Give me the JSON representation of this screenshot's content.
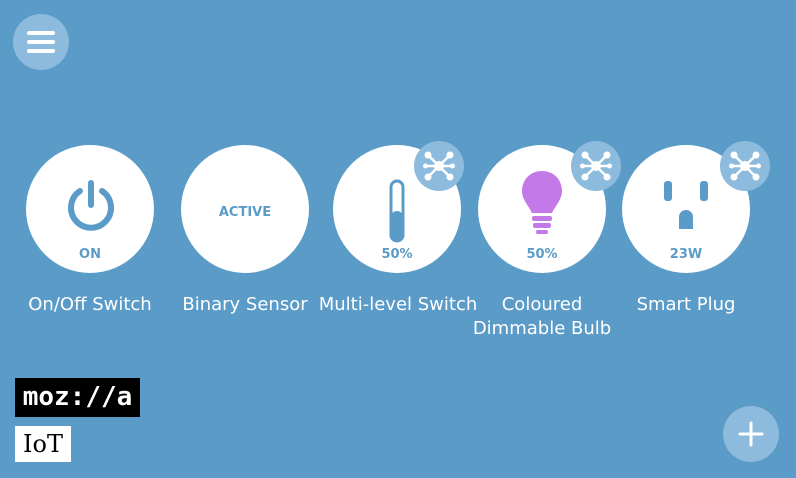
{
  "colors": {
    "background": "#5b9bc8",
    "accent": "#5b9bc8",
    "bulb": "#c479e8",
    "badge": "#8dbbdd"
  },
  "header": {
    "menu_icon": "hamburger-menu-icon"
  },
  "things": [
    {
      "label": "On/Off Switch",
      "status": "ON",
      "icon": "power-icon",
      "hub": false
    },
    {
      "label": "Binary Sensor",
      "status": "ACTIVE",
      "icon": "none",
      "hub": false
    },
    {
      "label": "Multi-level Switch",
      "status": "50%",
      "level": 0.5,
      "icon": "level-slider-icon",
      "hub": true
    },
    {
      "label": "Coloured Dimmable Bulb",
      "status": "50%",
      "icon": "lightbulb-icon",
      "hub": true
    },
    {
      "label": "Smart Plug",
      "status": "23W",
      "icon": "power-outlet-icon",
      "hub": true
    }
  ],
  "branding": {
    "logo_text": "moz://a",
    "product": "IoT"
  },
  "actions": {
    "add_icon": "plus-icon"
  }
}
